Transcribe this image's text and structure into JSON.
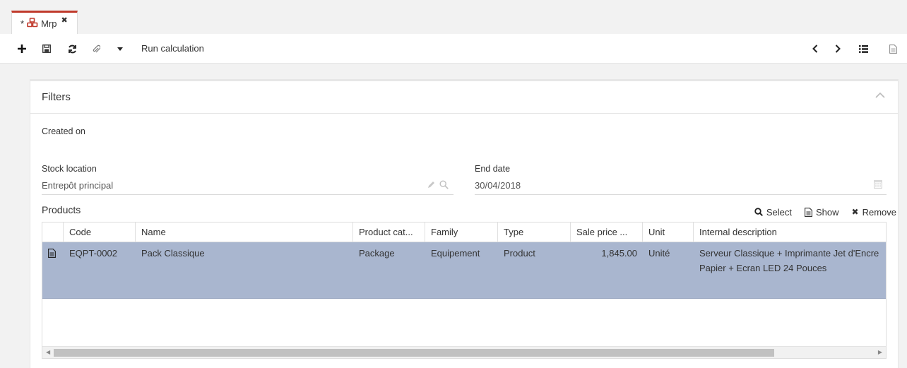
{
  "tab": {
    "dirty_marker": "*",
    "title": "Mrp",
    "icon": "cubes-icon",
    "accent": "#c0392b"
  },
  "toolbar": {
    "run_label": "Run calculation"
  },
  "filters": {
    "title": "Filters",
    "created_on_label": "Created on",
    "stock_location_label": "Stock location",
    "stock_location_value": "Entrepôt principal",
    "end_date_label": "End date",
    "end_date_value": "30/04/2018"
  },
  "products": {
    "title": "Products",
    "actions": {
      "select": "Select",
      "show": "Show",
      "remove": "Remove"
    },
    "columns": [
      "Code",
      "Name",
      "Product cat...",
      "Family",
      "Type",
      "Sale price ...",
      "Unit",
      "Internal description"
    ],
    "rows": [
      {
        "code": "EQPT-0002",
        "name": "Pack Classique",
        "product_category": "Package",
        "family": "Equipement",
        "type": "Product",
        "sale_price": "1,845.00",
        "unit": "Unité",
        "internal_description_line1": "Serveur Classique + Imprimante Jet d'Encre",
        "internal_description_line2": "Papier + Ecran LED 24 Pouces"
      }
    ],
    "selected_row_color": "#a9b6cf"
  }
}
